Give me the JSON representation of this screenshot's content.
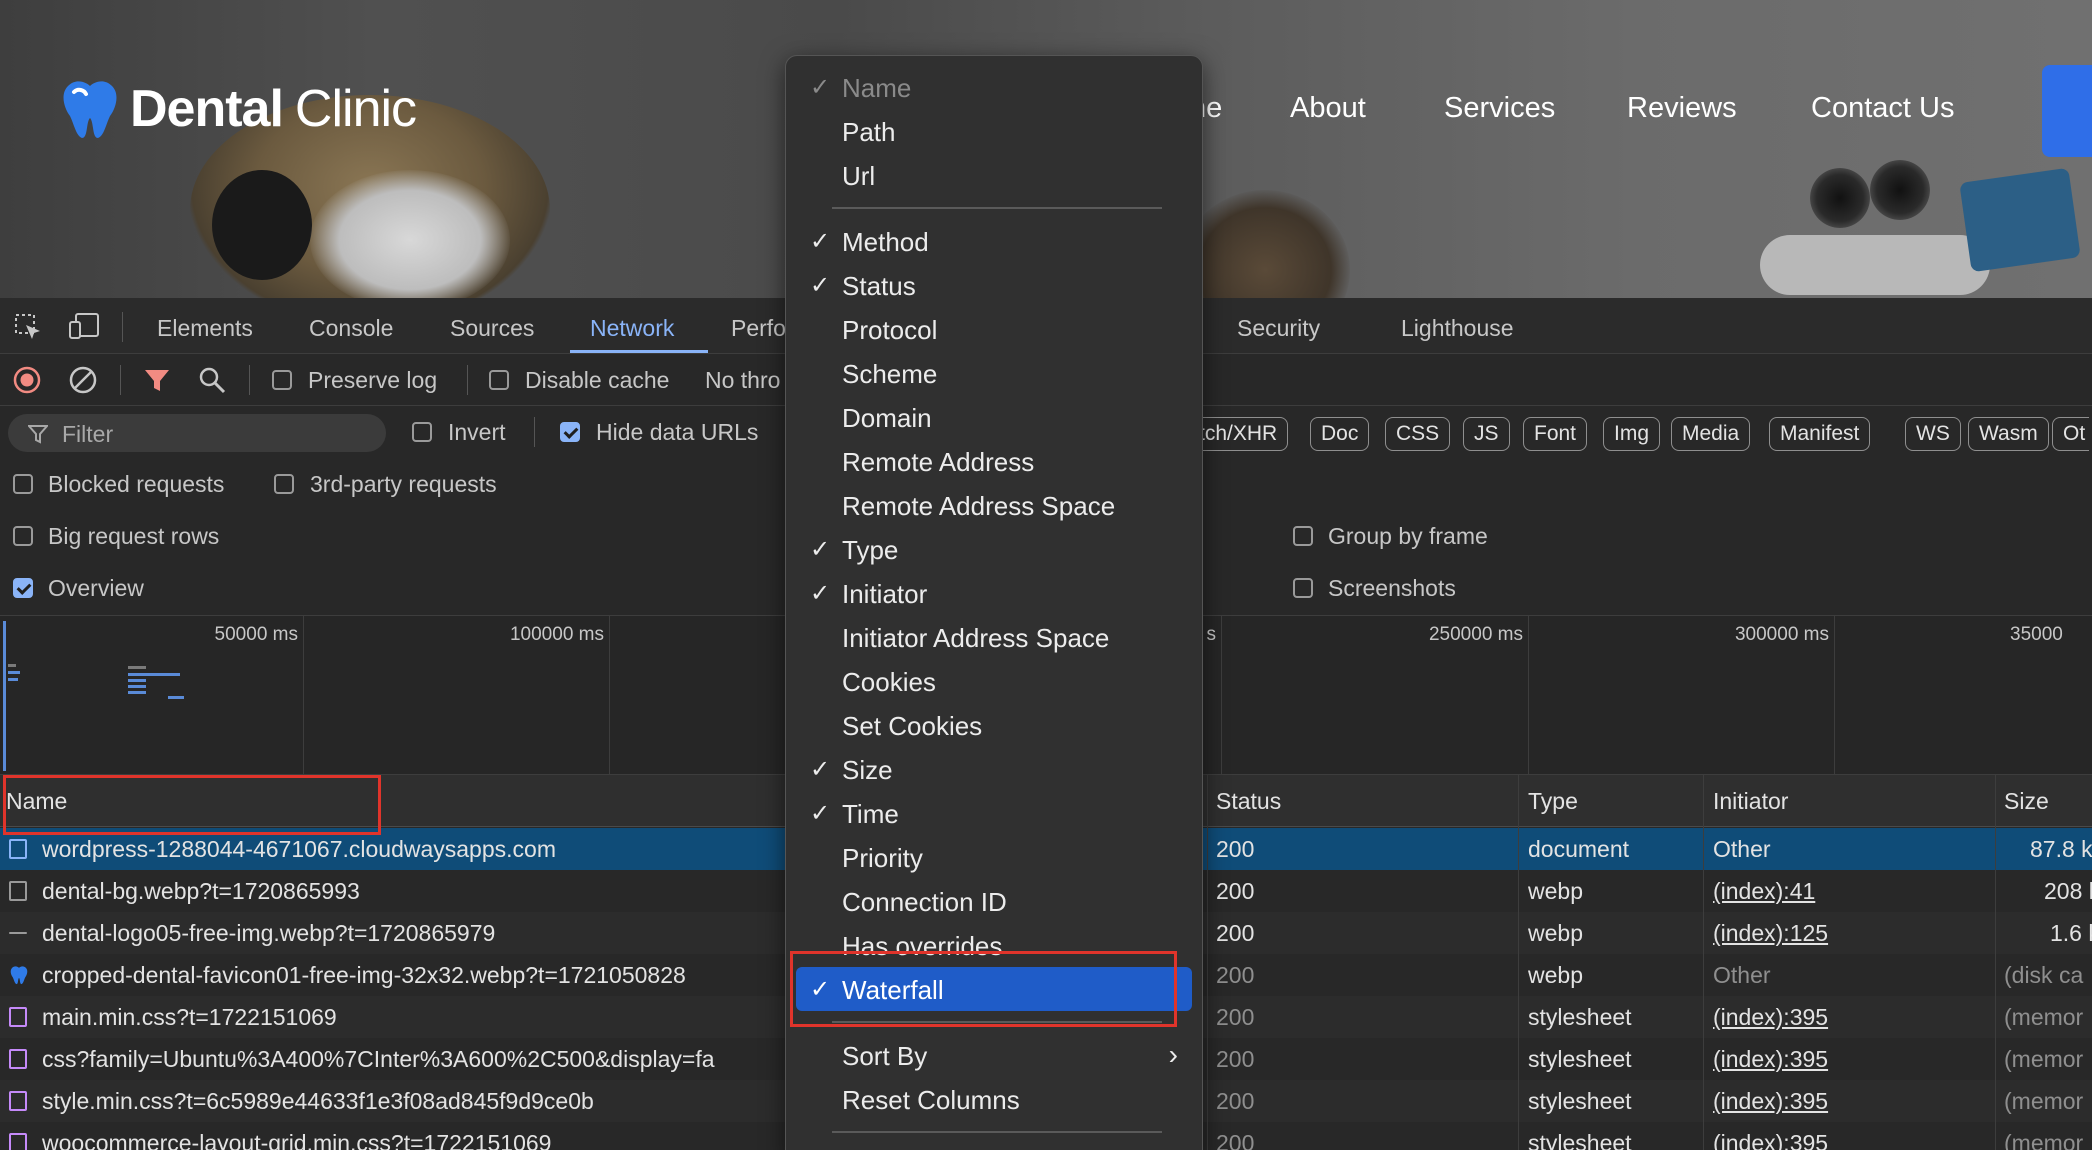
{
  "site": {
    "logo_bold": "Dental",
    "logo_light": "Clinic",
    "nav": {
      "home_partial": "ne",
      "about": "About",
      "services": "Services",
      "reviews": "Reviews",
      "contact": "Contact Us"
    },
    "cta_label": ""
  },
  "devtools": {
    "tabs": {
      "elements": "Elements",
      "console": "Console",
      "sources": "Sources",
      "network": "Network",
      "performance": "Perfo",
      "security": "Security",
      "lighthouse": "Lighthouse"
    },
    "toolbar": {
      "preserve_log": "Preserve log",
      "disable_cache": "Disable cache",
      "throttling": "No thro"
    },
    "filter": {
      "placeholder": "Filter",
      "invert": "Invert",
      "hide_data_urls": "Hide data URLs",
      "types": [
        "tch/XHR",
        "Doc",
        "CSS",
        "JS",
        "Font",
        "Img",
        "Media",
        "Manifest",
        "WS",
        "Wasm",
        "Ot"
      ]
    },
    "options": {
      "blocked": "Blocked requests",
      "third_party": "3rd-party requests",
      "big_rows": "Big request rows",
      "group_by_frame": "Group by frame",
      "overview": "Overview",
      "screenshots": "Screenshots"
    },
    "overview_ticks": [
      "50000 ms",
      "100000 ms",
      "s",
      "250000 ms",
      "300000 ms",
      "35000"
    ],
    "columns": {
      "name": "Name",
      "status": "Status",
      "type": "Type",
      "initiator": "Initiator",
      "size": "Size"
    },
    "rows": [
      {
        "name": "wordpress-1288044-4671067.cloudwaysapps.com",
        "status": "200",
        "type": "document",
        "initiator": "Other",
        "size": "87.8 k"
      },
      {
        "name": "dental-bg.webp?t=1720865993",
        "status": "200",
        "type": "webp",
        "initiator": "(index):41",
        "size": "208 k"
      },
      {
        "name": "dental-logo05-free-img.webp?t=1720865979",
        "status": "200",
        "type": "webp",
        "initiator": "(index):125",
        "size": "1.6 k"
      },
      {
        "name": "cropped-dental-favicon01-free-img-32x32.webp?t=1721050828",
        "status": "200",
        "type": "webp",
        "initiator": "Other",
        "size": "(disk ca"
      },
      {
        "name": "main.min.css?t=1722151069",
        "status": "200",
        "type": "stylesheet",
        "initiator": "(index):395",
        "size": "(memor"
      },
      {
        "name": "css?family=Ubuntu%3A400%7CInter%3A600%2C500&display=fa",
        "status": "200",
        "type": "stylesheet",
        "initiator": "(index):395",
        "size": "(memor"
      },
      {
        "name": "style.min.css?t=6c5989e44633f1e3f08ad845f9d9ce0b",
        "status": "200",
        "type": "stylesheet",
        "initiator": "(index):395",
        "size": "(memor"
      },
      {
        "name": "woocommerce-layout-grid.min.css?t=1722151069",
        "status": "200",
        "type": "stylesheet",
        "initiator": "(index):395",
        "size": "(memor"
      }
    ]
  },
  "menu": {
    "items": [
      {
        "label": "Name",
        "checked": true,
        "disabled": true
      },
      {
        "label": "Path",
        "checked": false
      },
      {
        "label": "Url",
        "checked": false
      },
      {
        "label": "Method",
        "checked": true
      },
      {
        "label": "Status",
        "checked": true
      },
      {
        "label": "Protocol",
        "checked": false
      },
      {
        "label": "Scheme",
        "checked": false
      },
      {
        "label": "Domain",
        "checked": false
      },
      {
        "label": "Remote Address",
        "checked": false
      },
      {
        "label": "Remote Address Space",
        "checked": false
      },
      {
        "label": "Type",
        "checked": true
      },
      {
        "label": "Initiator",
        "checked": true
      },
      {
        "label": "Initiator Address Space",
        "checked": false
      },
      {
        "label": "Cookies",
        "checked": false
      },
      {
        "label": "Set Cookies",
        "checked": false
      },
      {
        "label": "Size",
        "checked": true
      },
      {
        "label": "Time",
        "checked": true
      },
      {
        "label": "Priority",
        "checked": false
      },
      {
        "label": "Connection ID",
        "checked": false
      },
      {
        "label": "Has overrides",
        "checked": false
      },
      {
        "label": "Waterfall",
        "checked": true,
        "highlighted": true
      },
      {
        "label": "Sort By",
        "submenu": true
      },
      {
        "label": "Reset Columns"
      }
    ],
    "check_glyph": "✓",
    "submenu_glyph": "›"
  },
  "colors": {
    "accent": "#8ab4f8",
    "selected_row": "#0f4c78",
    "menu_highlight": "#1f5cc8",
    "annotation": "#e0342b",
    "cta": "#2f6ee8"
  }
}
